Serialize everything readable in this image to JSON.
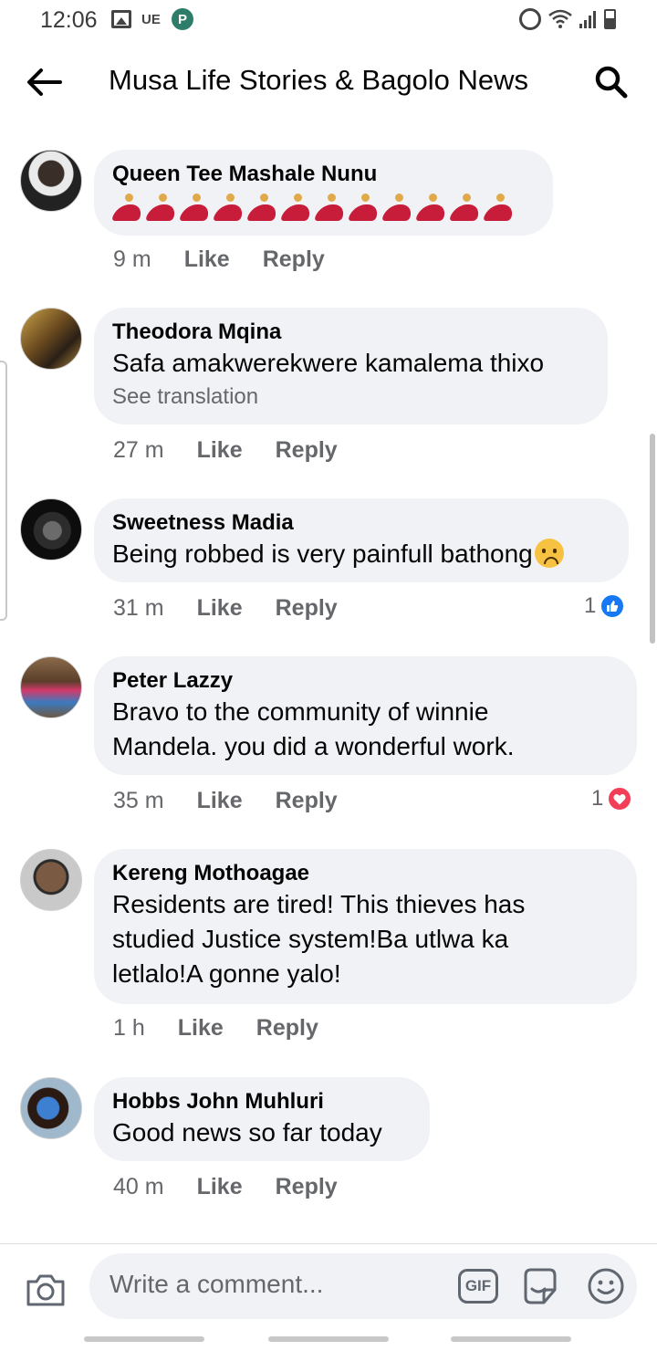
{
  "status_bar": {
    "time": "12:06",
    "carrier_icon_label": "UE",
    "p_icon_label": "P",
    "icons": [
      "gallery-icon",
      "ue-icon",
      "p-app-icon",
      "alarm-icon",
      "wifi-icon",
      "signal-icon",
      "battery-icon"
    ]
  },
  "header": {
    "title": "Musa Life Stories & Bagolo News",
    "back_icon": "arrow-left-icon",
    "search_icon": "search-icon"
  },
  "comments": [
    {
      "name": "Queen Tee Mashale Nunu",
      "text": "",
      "emoji": "dancer-emoji",
      "emoji_count": 12,
      "time": "9 m",
      "like_label": "Like",
      "reply_label": "Reply"
    },
    {
      "name": "Theodora Mqina",
      "text": "Safa amakwerekwere kamalema thixo",
      "translation_label": "See translation",
      "time": "27 m",
      "like_label": "Like",
      "reply_label": "Reply"
    },
    {
      "name": "Sweetness Madia",
      "text": "Being robbed is very painfull bathong",
      "trailing_emoji": "sad-tear-emoji",
      "time": "31 m",
      "like_label": "Like",
      "reply_label": "Reply",
      "reaction_count": "1",
      "reaction_type": "like"
    },
    {
      "name": "Peter Lazzy",
      "text": "Bravo to the community of winnie Mandela. you did a wonderful work.",
      "time": "35 m",
      "like_label": "Like",
      "reply_label": "Reply",
      "reaction_count": "1",
      "reaction_type": "love"
    },
    {
      "name": "Kereng Mothoagae",
      "text": "Residents are tired! This thieves has studied Justice system!Ba utlwa ka letlalo!A gonne yalo!",
      "time": "1 h",
      "like_label": "Like",
      "reply_label": "Reply"
    },
    {
      "name": "Hobbs John Muhluri",
      "text": "Good news so far today",
      "time": "40 m",
      "like_label": "Like",
      "reply_label": "Reply"
    }
  ],
  "composer": {
    "placeholder": "Write a comment...",
    "gif_label": "GIF",
    "camera_icon": "camera-icon",
    "sticker_icon": "sticker-icon",
    "emoji_icon": "smiley-icon"
  },
  "colors": {
    "bubble": "#f0f2f5",
    "meta_text": "#65676b",
    "like_blue": "#1877f2",
    "love_red": "#f33e58"
  }
}
